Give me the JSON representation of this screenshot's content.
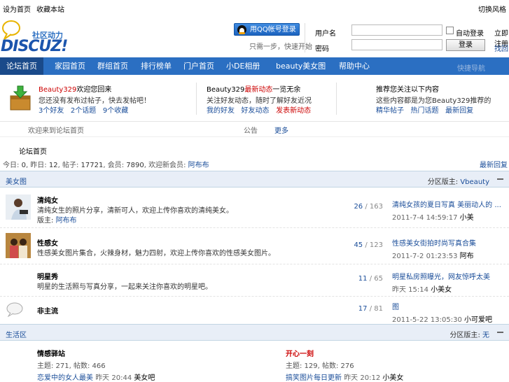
{
  "topbar": {
    "left": [
      "设为首页",
      "收藏本站"
    ],
    "right": "切换风格"
  },
  "logo": {
    "cn": "社区动力",
    "en": "DISCUZ!"
  },
  "qq": {
    "button": "用QQ帐号登录",
    "sub": "只需一步，快速开始"
  },
  "login": {
    "user_label": "用户名",
    "pass_label": "密码",
    "remember": "自动登录",
    "register": "立即注册",
    "submit": "登录",
    "forgot": "找回",
    "colors": {
      "accent": "#2b6fc2"
    }
  },
  "nav": {
    "items": [
      "论坛首页",
      "家园首页",
      "群组首页",
      "排行榜单",
      "门户首页",
      "小DE相册",
      "beauty美女图",
      "帮助中心"
    ],
    "search": "快捷导航"
  },
  "info": {
    "col1": {
      "title_user": "Beauty329",
      "title_rest": "欢迎您回来",
      "line2": "您还没有发布过帖子，快去发帖吧！",
      "links": [
        "3个好友",
        "2个话题",
        "9个收藏"
      ]
    },
    "col2": {
      "title_user": "Beauty329",
      "title_red": "最新动态",
      "title_rest": "一览无余",
      "line2": "关注好友动态，随时了解好友近况",
      "links": [
        "我的好友",
        "好友动态",
        "发表新动态"
      ]
    },
    "col3": {
      "title": "推荐您关注以下内容",
      "line2": "这些内容都是为您Beauty329推荐的",
      "links": [
        "精华帖子",
        "热门话题",
        "最新回复"
      ]
    }
  },
  "bar2": {
    "text": "欢迎来到论坛首页",
    "mid": "公告",
    "link": "更多"
  },
  "section_title": "论坛首页",
  "stats": {
    "today_label": "今日",
    "today": "0",
    "yesterday_label": "昨日",
    "yesterday": "12",
    "posts_label": "帖子",
    "posts": "17721",
    "members_label": "会员",
    "members": "7890",
    "newest_label": "欢迎新会员",
    "newest": "阿布布",
    "right": "最新回复"
  },
  "sections": [
    {
      "title": "美女图",
      "mod_label": "分区版主",
      "mod": "Vbeauty"
    },
    {
      "title": "生活区",
      "mod_label": "分区版主",
      "mod": "无"
    }
  ],
  "forums": [
    {
      "name": "清纯女",
      "desc": "清纯女生的照片分享，清新可人，欢迎上传你喜欢的清纯美女。",
      "mod_label": "版主",
      "mod": "阿布布",
      "threads": "26",
      "posts": "163",
      "last_title": "清纯女孩的夏日写真 美丽动人的 ...",
      "last_time": "2011-7-4 14:59:17",
      "last_user": "小美"
    },
    {
      "name": "性感女",
      "desc": "性感美女图片集合，火辣身材，魅力四射，欢迎上传你喜欢的性感美女图片。",
      "threads": "45",
      "posts": "123",
      "last_title": "性感美女街拍时尚写真合集",
      "last_time": "2011-7-2 01:23:53",
      "last_user": "阿布"
    },
    {
      "name": "明星秀",
      "desc": "明星的生活照与写真分享，一起来关注你喜欢的明星吧。",
      "threads": "11",
      "posts": "65",
      "last_title": "明星私房照曝光，网友惊呼太美",
      "last_time": "昨天 15:14",
      "last_user": "小美女"
    },
    {
      "name": "非主流",
      "desc": "",
      "threads": "17",
      "posts": "81",
      "last_title": "图",
      "last_time": "2011-5-22 13:05:30",
      "last_user": "小可爱吧"
    }
  ],
  "life": [
    {
      "name": "情感驿站",
      "stats": "主题: 271, 帖数: 466",
      "last_title": "恋爱中的女人最美",
      "last_time": "昨天 20:44",
      "last_user": "美女吧"
    },
    {
      "name": "开心一刻",
      "stats": "主题: 129, 帖数: 276",
      "last_title": "搞笑图片每日更新",
      "last_time": "昨天 20:12",
      "last_user": "小美女"
    }
  ]
}
